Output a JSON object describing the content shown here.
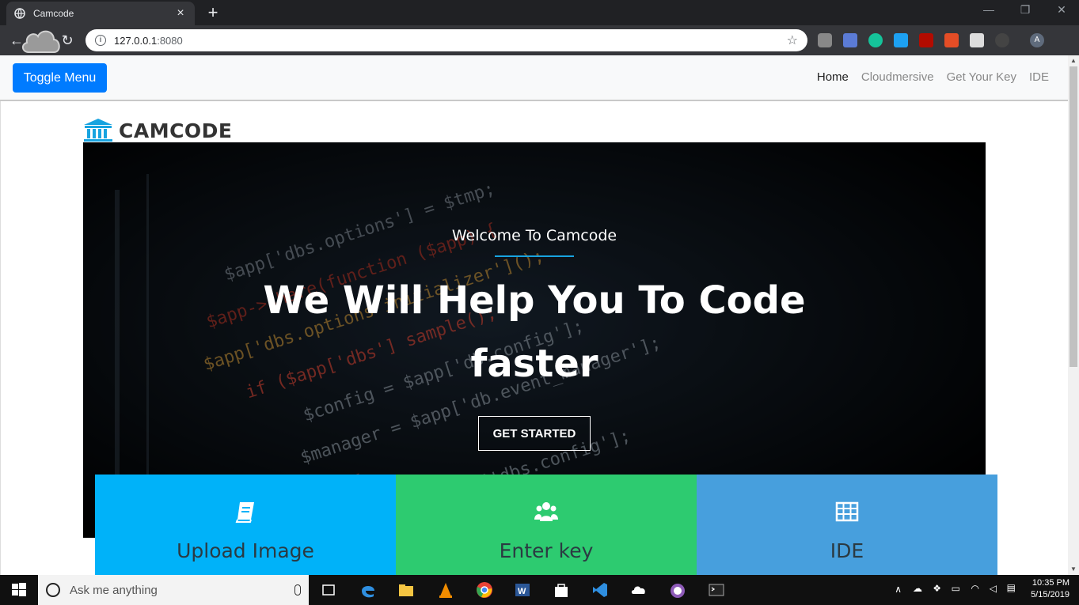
{
  "browser": {
    "tab_title": "Camcode",
    "url_host": "127.0.0.1",
    "url_port": ":8080"
  },
  "nav": {
    "toggle_label": "Toggle Menu",
    "links": [
      "Home",
      "Cloudmersive",
      "Get Your Key",
      "IDE"
    ],
    "active": "Home"
  },
  "brand": {
    "name": "CAMCODE",
    "color": "#18a4e0"
  },
  "hero": {
    "subtitle": "Welcome To Camcode",
    "title": "We Will Help You To Code faster",
    "cta_label": "GET STARTED"
  },
  "features": [
    {
      "label": "Upload Image",
      "icon": "book-icon",
      "color": "#00b2f9"
    },
    {
      "label": "Enter key",
      "icon": "users-icon",
      "color": "#2dcb70"
    },
    {
      "label": "IDE",
      "icon": "grid-icon",
      "color": "#479fdd"
    }
  ],
  "taskbar": {
    "search_placeholder": "Ask me anything",
    "time": "10:35 PM",
    "date": "5/15/2019"
  },
  "extension_avatar": "A"
}
